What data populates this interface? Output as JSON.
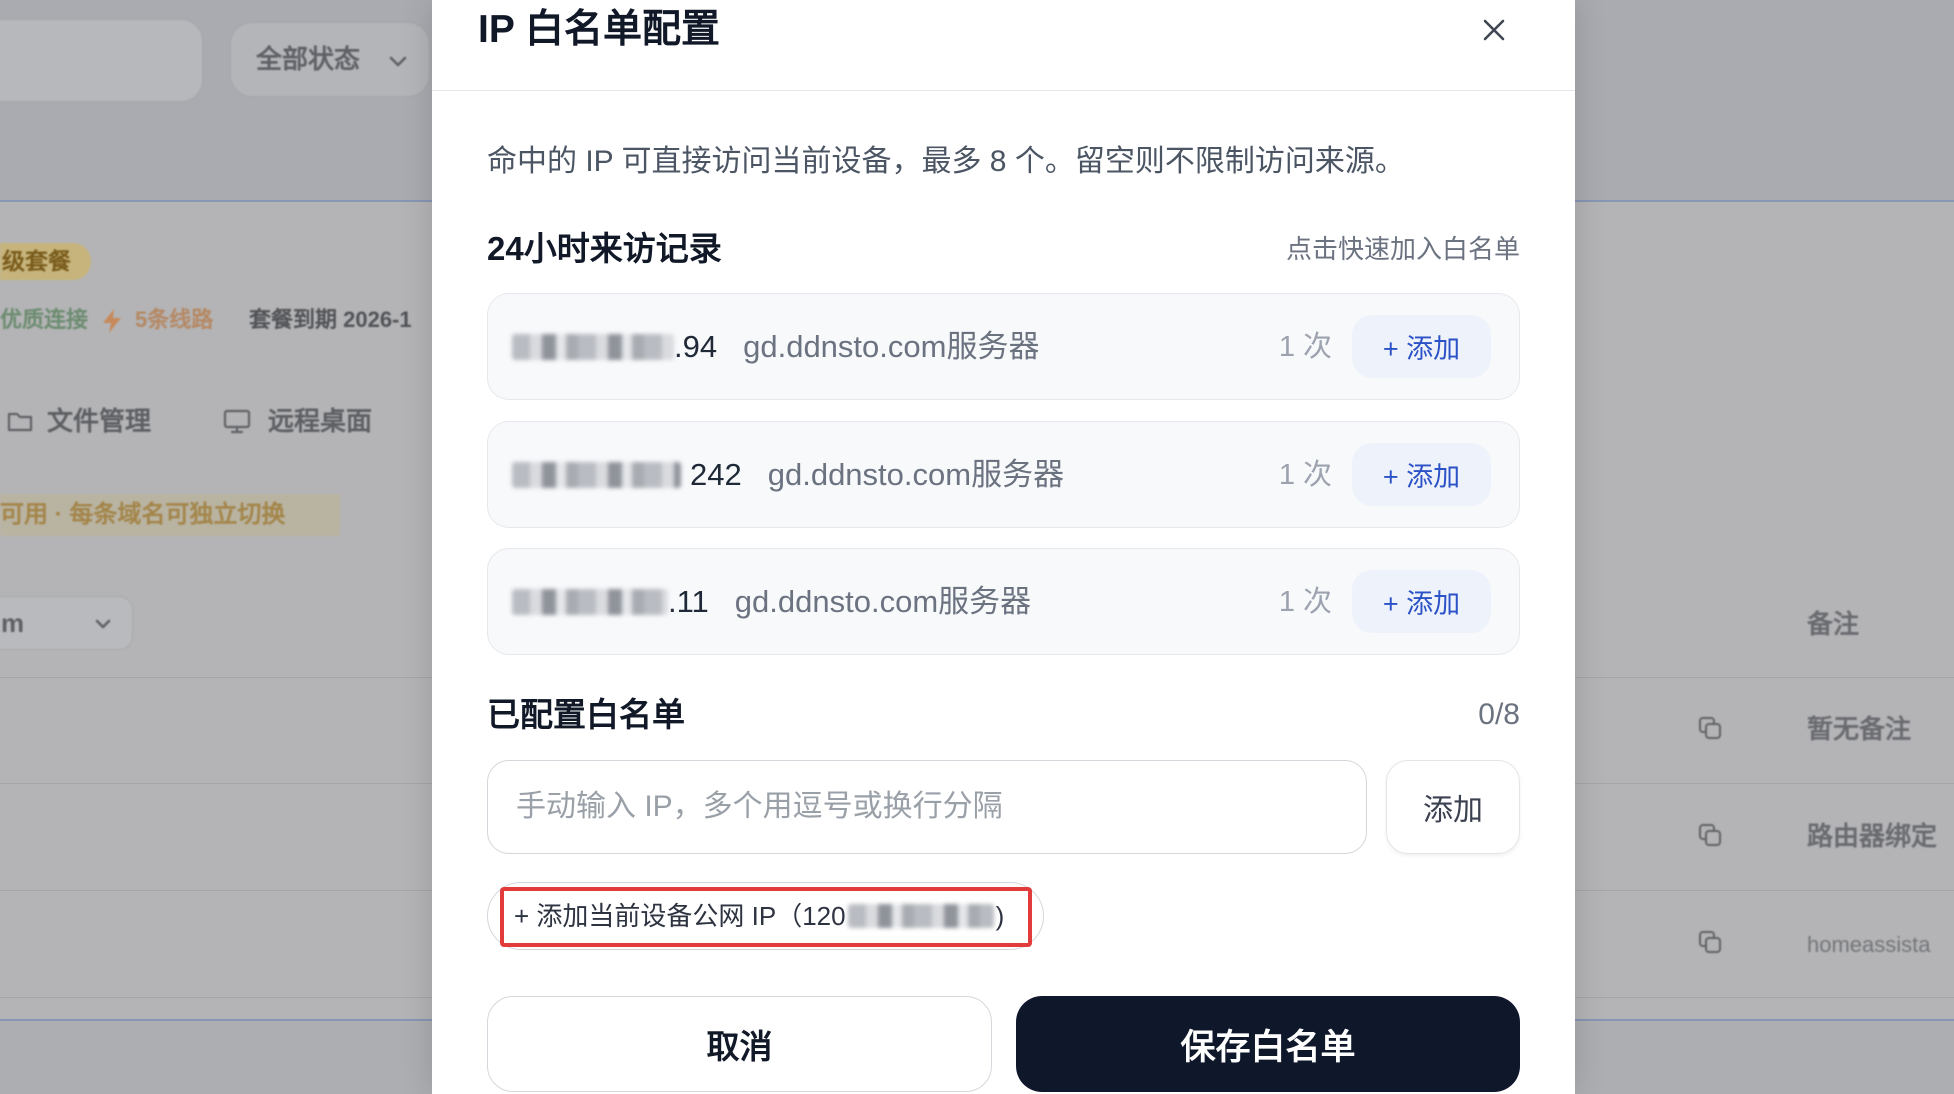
{
  "background": {
    "status_filter": "全部状态",
    "plan_badge": "级套餐",
    "quality": "优质连接",
    "lines": "5条线路",
    "expiry": "套餐到期 2026-1",
    "nav": [
      {
        "label": "文件管理",
        "icon": "folder-icon"
      },
      {
        "label": "远程桌面",
        "icon": "monitor-icon"
      }
    ],
    "notice": "可用 · 每条域名可独立切换",
    "domain_select": "m",
    "notes_header": "备注",
    "notes": [
      "暂无备注",
      "路由器绑定",
      "homeassista"
    ]
  },
  "modal": {
    "title": "IP 白名单配置",
    "description": "命中的 IP 可直接访问当前设备，最多 8 个。留空则不限制访问来源。",
    "recent": {
      "heading": "24小时来访记录",
      "hint": "点击快速加入白名单",
      "items": [
        {
          "ip_visible": ".94",
          "source": "gd.ddnsto.com服务器",
          "count": "1 次",
          "action": "+ 添加"
        },
        {
          "ip_visible": "242",
          "source": "gd.ddnsto.com服务器",
          "count": "1 次",
          "action": "+ 添加"
        },
        {
          "ip_visible": ".11",
          "source": "gd.ddnsto.com服务器",
          "count": "1 次",
          "action": "+ 添加"
        }
      ]
    },
    "configured": {
      "heading": "已配置白名单",
      "count": "0/8",
      "input_placeholder": "手动输入 IP，多个用逗号或换行分隔",
      "add_button": "添加",
      "current_ip_prefix": "+ 添加当前设备公网 IP（120",
      "current_ip_suffix": ")"
    },
    "cancel": "取消",
    "save": "保存白名单"
  },
  "icons": {
    "close": "close-icon",
    "chevron": "chevron-down-icon",
    "lightning": "lightning-icon",
    "copy": "copy-icon"
  },
  "colors": {
    "accent_blue": "#2b52c6",
    "quick_add_bg": "#eef2fb",
    "primary_dark": "#0f172a",
    "annotation_red": "#e23b3b",
    "muted_text": "#6b7280"
  }
}
